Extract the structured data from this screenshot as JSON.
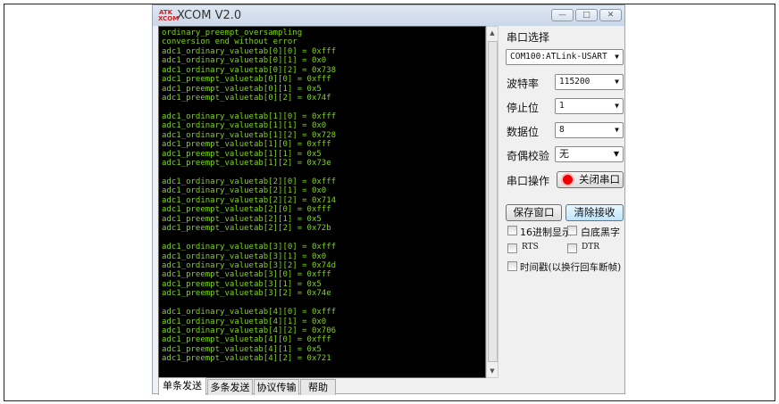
{
  "window": {
    "logo": "ATK",
    "title": "XCOM V2.0",
    "min": "—",
    "max": "□",
    "close": "✕"
  },
  "terminal": {
    "lines": [
      "ordinary_preempt_oversampling",
      "conversion end without error",
      "adc1_ordinary_valuetab[0][0] = 0xfff",
      "adc1_ordinary_valuetab[0][1] = 0x0",
      "adc1_ordinary_valuetab[0][2] = 0x738",
      "adc1_preempt_valuetab[0][0] = 0xfff",
      "adc1_preempt_valuetab[0][1] = 0x5",
      "adc1_preempt_valuetab[0][2] = 0x74f",
      "",
      "adc1_ordinary_valuetab[1][0] = 0xfff",
      "adc1_ordinary_valuetab[1][1] = 0x0",
      "adc1_ordinary_valuetab[1][2] = 0x728",
      "adc1_preempt_valuetab[1][0] = 0xfff",
      "adc1_preempt_valuetab[1][1] = 0x5",
      "adc1_preempt_valuetab[1][2] = 0x73e",
      "",
      "adc1_ordinary_valuetab[2][0] = 0xfff",
      "adc1_ordinary_valuetab[2][1] = 0x0",
      "adc1_ordinary_valuetab[2][2] = 0x714",
      "adc1_preempt_valuetab[2][0] = 0xfff",
      "adc1_preempt_valuetab[2][1] = 0x5",
      "adc1_preempt_valuetab[2][2] = 0x72b",
      "",
      "adc1_ordinary_valuetab[3][0] = 0xfff",
      "adc1_ordinary_valuetab[3][1] = 0x0",
      "adc1_ordinary_valuetab[3][2] = 0x74d",
      "adc1_preempt_valuetab[3][0] = 0xfff",
      "adc1_preempt_valuetab[3][1] = 0x5",
      "adc1_preempt_valuetab[3][2] = 0x74e",
      "",
      "adc1_ordinary_valuetab[4][0] = 0xfff",
      "adc1_ordinary_valuetab[4][1] = 0x0",
      "adc1_ordinary_valuetab[4][2] = 0x706",
      "adc1_preempt_valuetab[4][0] = 0xfff",
      "adc1_preempt_valuetab[4][1] = 0x5",
      "adc1_preempt_valuetab[4][2] = 0x721"
    ]
  },
  "panel": {
    "port_label": "串口选择",
    "port_value": "COM100:ATLink-USART",
    "baud_label": "波特率",
    "baud_value": "115200",
    "stop_label": "停止位",
    "stop_value": "1",
    "data_label": "数据位",
    "data_value": "8",
    "parity_label": "奇偶校验",
    "parity_value": "无",
    "op_label": "串口操作",
    "op_button": "关闭串口",
    "save_button": "保存窗口",
    "clear_button": "清除接收",
    "hex_display": "16进制显示",
    "white_bg": "白底黑字",
    "rts": "RTS",
    "dtr": "DTR",
    "timestamp": "时间戳(以换行回车断帧)"
  },
  "tabs": [
    "单条发送",
    "多条发送",
    "协议传输",
    "帮助"
  ],
  "colors": {
    "terminal_text": "#7fd318",
    "terminal_bg": "#000000"
  }
}
